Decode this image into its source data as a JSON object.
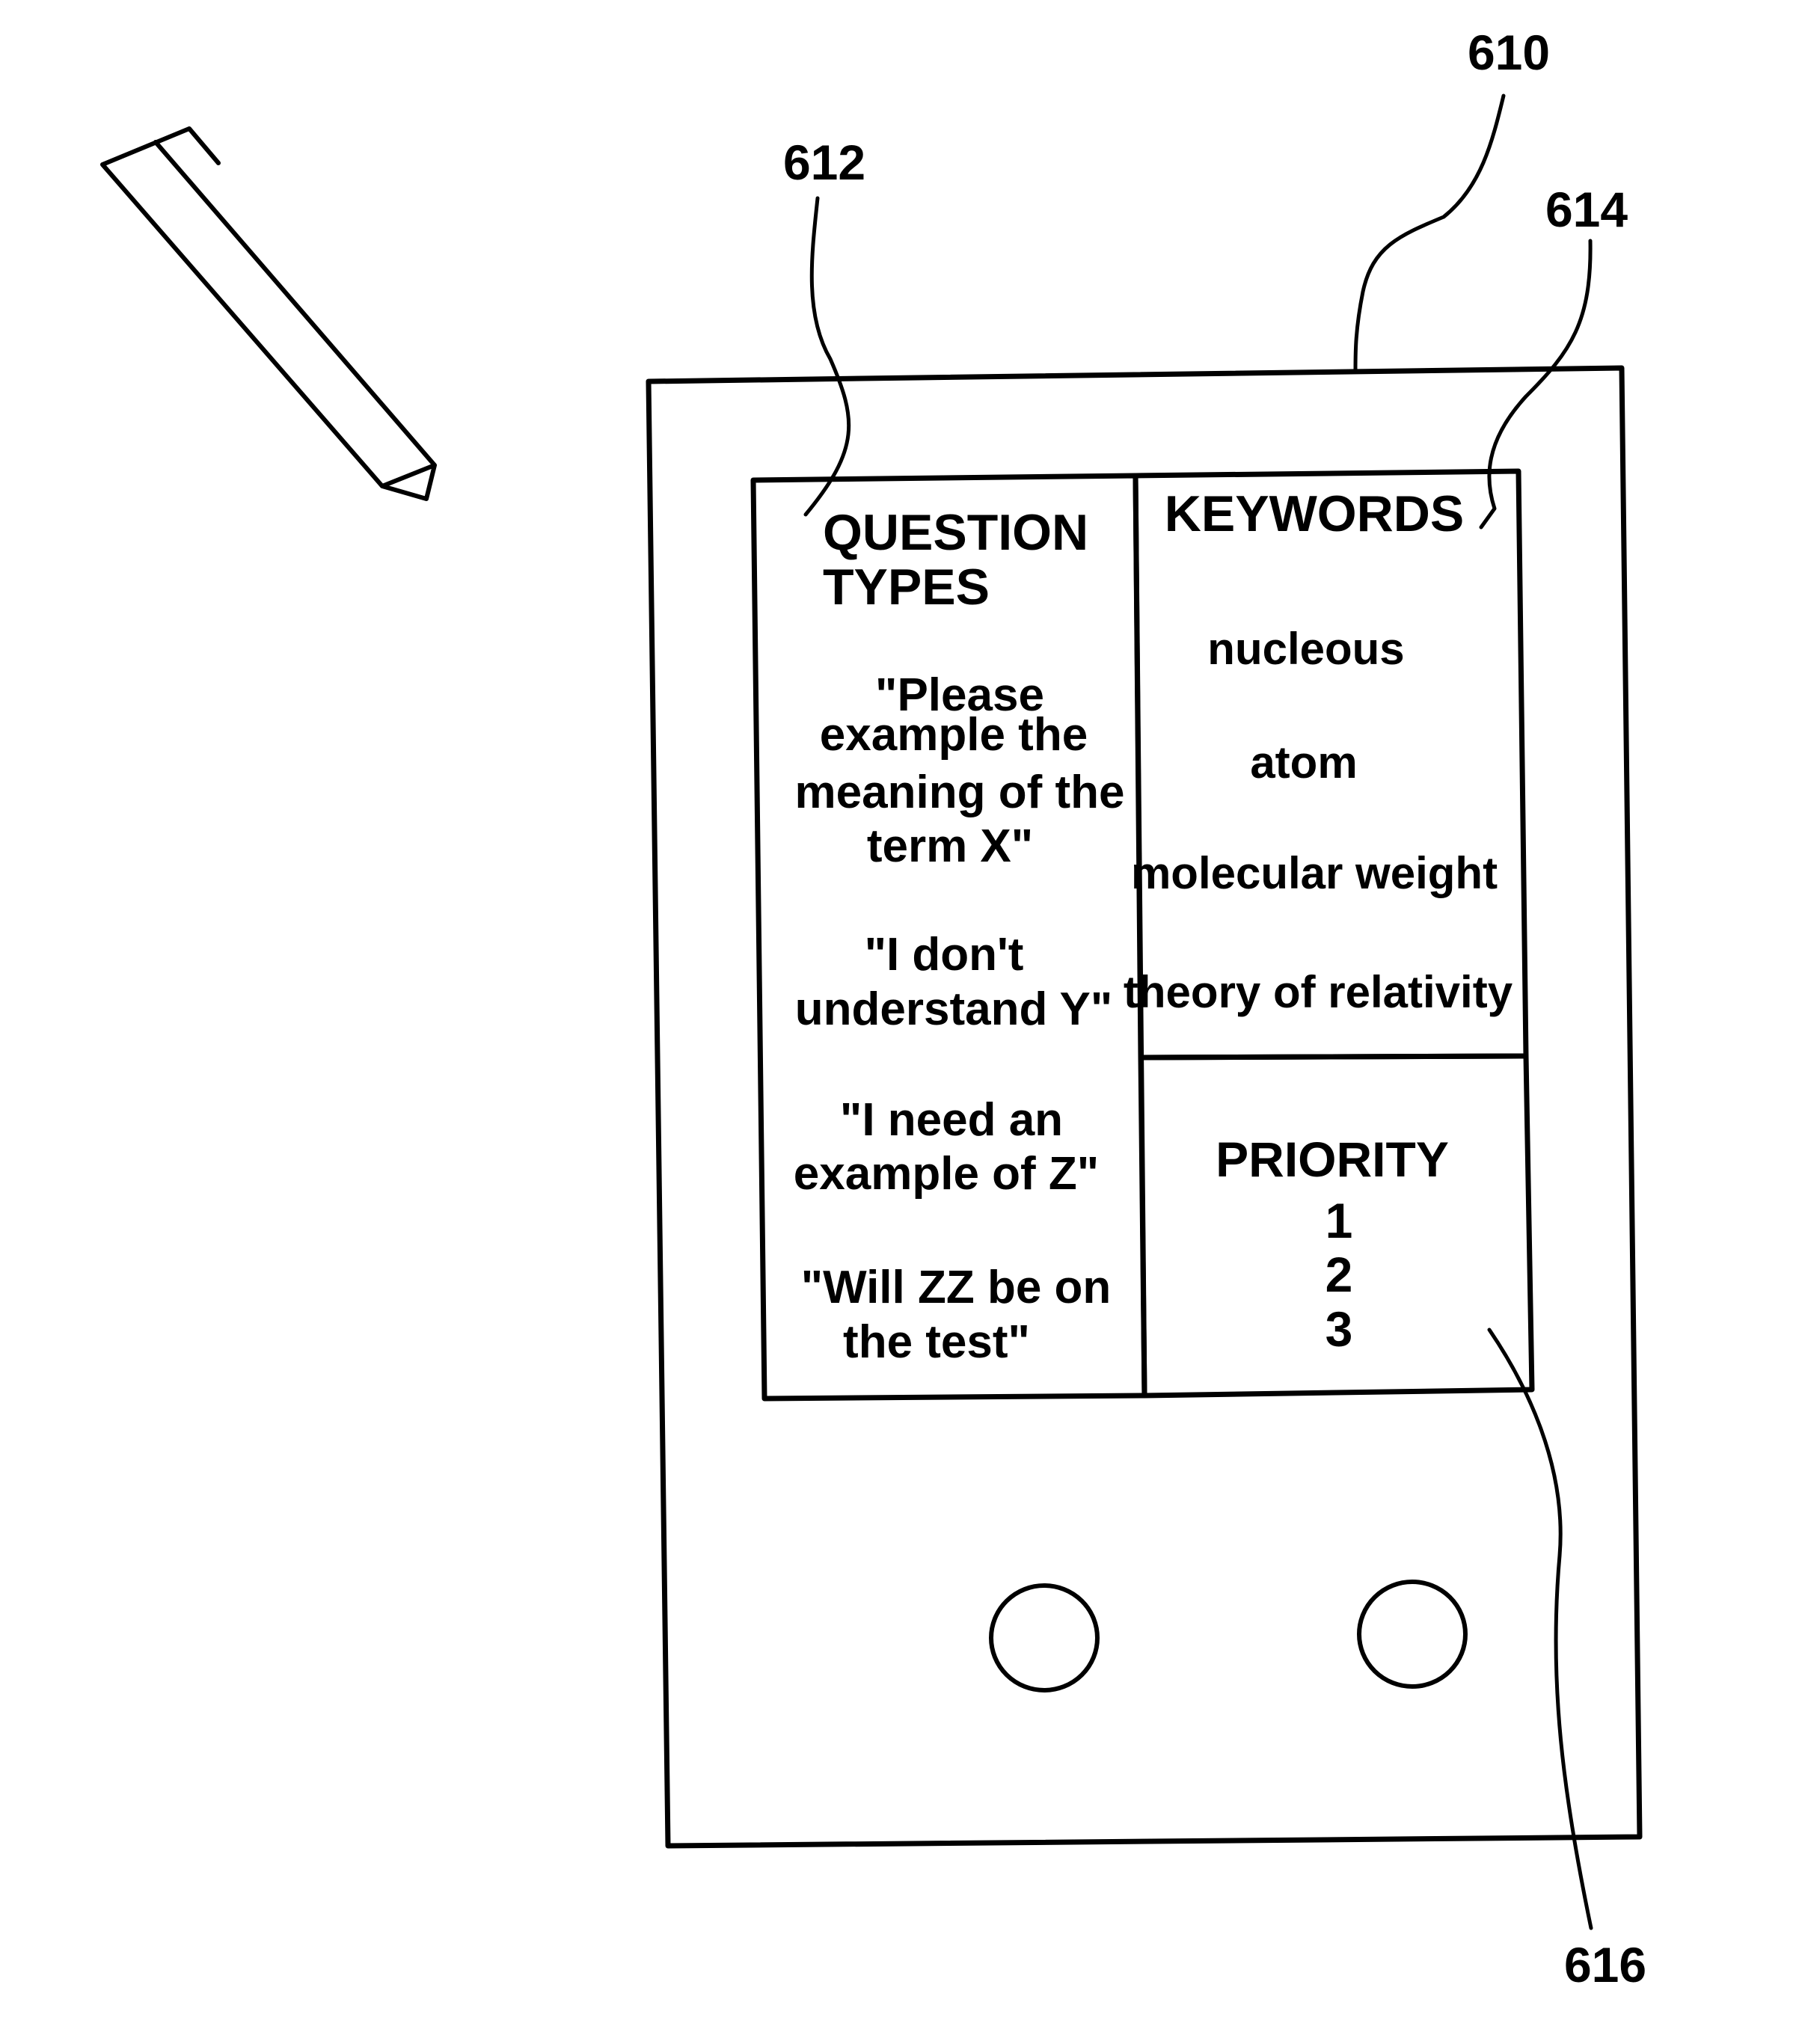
{
  "figure": {
    "reference_numerals": {
      "device": "610",
      "question_types_panel": "612",
      "keywords_panel": "614",
      "priority_panel": "616"
    },
    "question_types": {
      "heading_lines": [
        "QUESTION",
        "TYPES"
      ],
      "items": [
        [
          "\"Please",
          "example the",
          "meaning of the",
          "term X\""
        ],
        [
          "\"I don't",
          "understand Y\""
        ],
        [
          "\"I need an",
          "example of Z\""
        ],
        [
          "\"Will ZZ be on",
          "the test\""
        ]
      ]
    },
    "keywords": {
      "heading": "KEYWORDS",
      "items": [
        "nucleous",
        "atom",
        "molecular weight",
        "theory of relativity"
      ]
    },
    "priority": {
      "heading": "PRIORITY",
      "levels": [
        "1",
        "2",
        "3"
      ]
    },
    "device_buttons": [
      "left-button",
      "right-button"
    ],
    "stylus": "stylus-pen-icon",
    "colors": {
      "ink": "#000000",
      "paper": "#ffffff"
    }
  }
}
